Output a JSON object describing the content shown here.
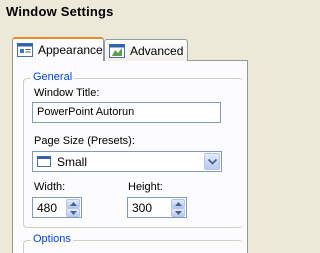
{
  "window": {
    "title": "Window Settings"
  },
  "tabs": [
    {
      "label": "Appearance",
      "icon": "appearance-tab-icon",
      "active": true
    },
    {
      "label": "Advanced",
      "icon": "advanced-tab-icon",
      "active": false
    }
  ],
  "general": {
    "legend": "General",
    "window_title_label": "Window Title:",
    "window_title_value": "PowerPoint Autorun",
    "page_size_label": "Page Size (Presets):",
    "page_size_value": "Small",
    "width_label": "Width:",
    "width_value": "480",
    "height_label": "Height:",
    "height_value": "300"
  },
  "options": {
    "legend": "Options"
  },
  "colors": {
    "background": "#ece9d8",
    "panel": "#fcfcfe",
    "group_legend": "#0046d5",
    "active_tab_accent": "#e68b2c",
    "input_border": "#7f9db9"
  }
}
